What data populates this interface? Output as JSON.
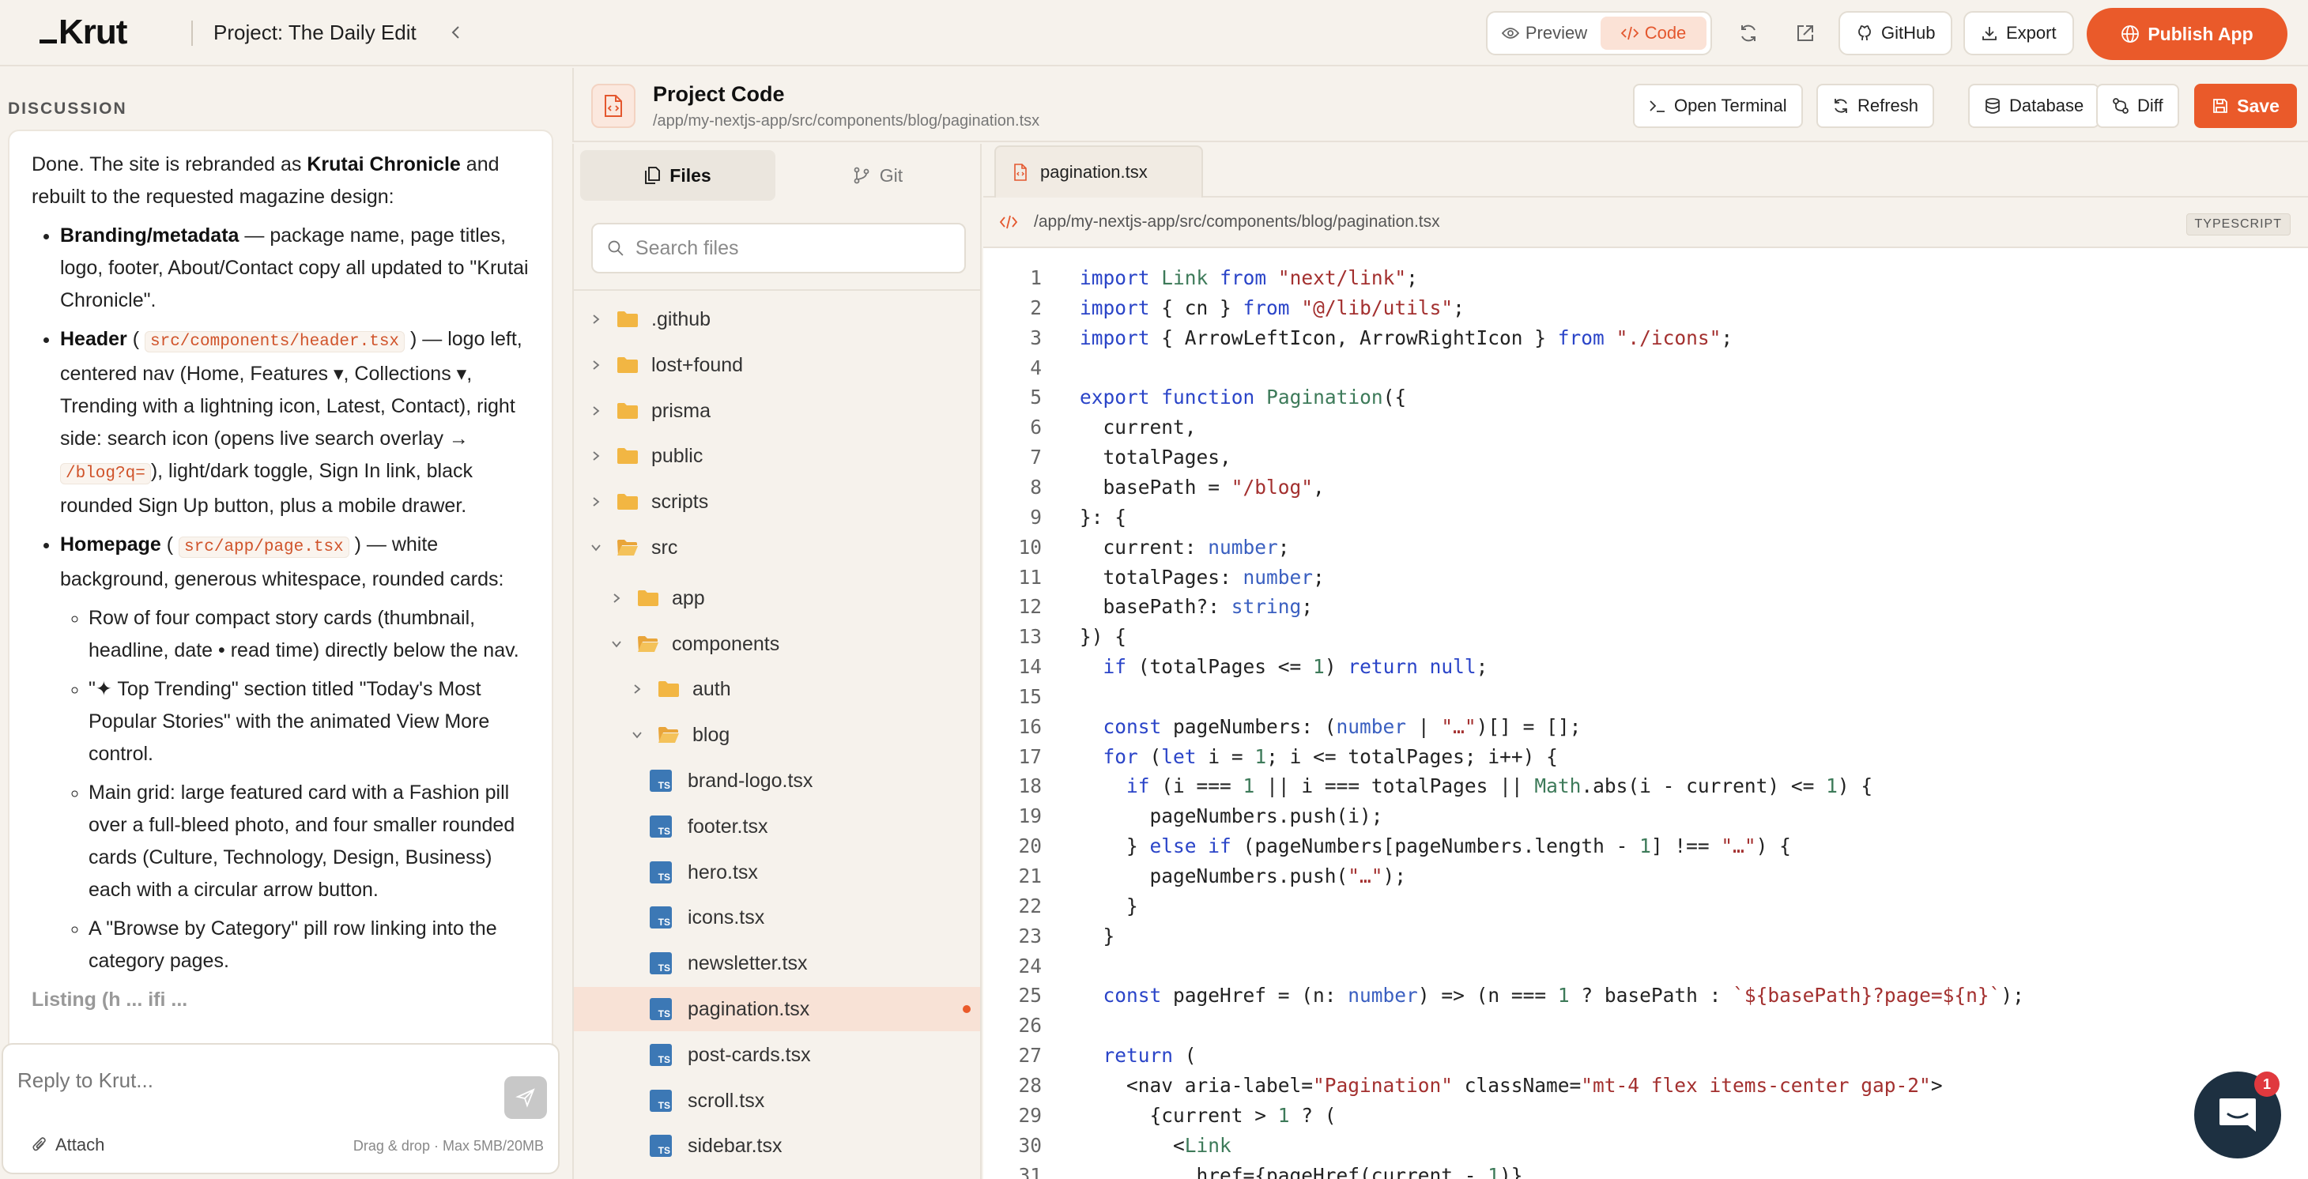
{
  "app": {
    "logo": "Krut",
    "project_title": "Project: The Daily Edit"
  },
  "topbar": {
    "preview_label": "Preview",
    "code_label": "Code",
    "github_label": "GitHub",
    "export_label": "Export",
    "publish_label": "Publish App"
  },
  "discussion": {
    "section_label": "DISCUSSION",
    "intro_pre": "Done. The site is rebranded as ",
    "intro_brand": "Krutai Chronicle",
    "intro_post": " and rebuilt to the requested magazine design:",
    "items": [
      {
        "title": "Branding/metadata",
        "text": " — package name, page titles, logo, footer, About/Contact copy all updated to \"Krutai Chronicle\"."
      },
      {
        "title": "Header",
        "code": "src/components/header.tsx",
        "text_a": " — logo left, centered nav (Home, Features ▾, Collections ▾, Trending with a lightning icon, Latest, Contact), right side: search icon (opens live search overlay → ",
        "code2": "/blog?q=",
        "text_b": "), light/dark toggle, Sign In link, black rounded Sign Up button, plus a mobile drawer."
      },
      {
        "title": "Homepage",
        "code": "src/app/page.tsx",
        "text": " — white background, generous whitespace, rounded cards:",
        "sub": [
          "Row of four compact story cards (thumbnail, headline, date • read time) directly below the nav.",
          "\"✦ Top Trending\" section titled \"Today's Most Popular Stories\" with the animated View More control.",
          "Main grid: large featured card with a Fashion pill over a full-bleed photo, and four smaller rounded cards (Culture, Technology, Design, Business) each with a circular arrow button.",
          "A \"Browse by Category\" pill row linking into the category pages."
        ]
      }
    ],
    "fade_text": "Listing (h ... ifi ..."
  },
  "reply": {
    "placeholder": "Reply to Krut...",
    "attach_label": "Attach",
    "drop_note": "Drag & drop · Max 5MB/20MB"
  },
  "project_code": {
    "title": "Project Code",
    "path": "/app/my-nextjs-app/src/components/blog/pagination.tsx",
    "open_terminal_label": "Open Terminal",
    "refresh_label": "Refresh",
    "database_label": "Database",
    "diff_label": "Diff",
    "save_label": "Save"
  },
  "tree": {
    "files_tab": "Files",
    "git_tab": "Git",
    "search_placeholder": "Search files",
    "rows": [
      {
        "label": ".github",
        "kind": "folder",
        "depth": 0,
        "open": false
      },
      {
        "label": "lost+found",
        "kind": "folder",
        "depth": 0,
        "open": false
      },
      {
        "label": "prisma",
        "kind": "folder",
        "depth": 0,
        "open": false
      },
      {
        "label": "public",
        "kind": "folder",
        "depth": 0,
        "open": false
      },
      {
        "label": "scripts",
        "kind": "folder",
        "depth": 0,
        "open": false
      },
      {
        "label": "src",
        "kind": "folder-open",
        "depth": 0,
        "open": true
      },
      {
        "label": "app",
        "kind": "folder",
        "depth": 1,
        "open": false
      },
      {
        "label": "components",
        "kind": "folder-open",
        "depth": 1,
        "open": true
      },
      {
        "label": "auth",
        "kind": "folder",
        "depth": 2,
        "open": false
      },
      {
        "label": "blog",
        "kind": "folder-open",
        "depth": 2,
        "open": true
      },
      {
        "label": "brand-logo.tsx",
        "kind": "file",
        "depth": 3
      },
      {
        "label": "footer.tsx",
        "kind": "file",
        "depth": 3
      },
      {
        "label": "hero.tsx",
        "kind": "file",
        "depth": 3
      },
      {
        "label": "icons.tsx",
        "kind": "file",
        "depth": 3
      },
      {
        "label": "newsletter.tsx",
        "kind": "file",
        "depth": 3
      },
      {
        "label": "pagination.tsx",
        "kind": "file",
        "depth": 3,
        "selected": true,
        "modified": true
      },
      {
        "label": "post-cards.tsx",
        "kind": "file",
        "depth": 3
      },
      {
        "label": "scroll.tsx",
        "kind": "file",
        "depth": 3
      },
      {
        "label": "sidebar.tsx",
        "kind": "file",
        "depth": 3
      }
    ]
  },
  "editor": {
    "tab_label": "pagination.tsx",
    "path": "/app/my-nextjs-app/src/components/blog/pagination.tsx",
    "language": "TYPESCRIPT",
    "lines": [
      "import Link from \"next/link\";",
      "import { cn } from \"@/lib/utils\";",
      "import { ArrowLeftIcon, ArrowRightIcon } from \"./icons\";",
      "",
      "export function Pagination({",
      "  current,",
      "  totalPages,",
      "  basePath = \"/blog\",",
      "}: {",
      "  current: number;",
      "  totalPages: number;",
      "  basePath?: string;",
      "}) {",
      "  if (totalPages <= 1) return null;",
      "",
      "  const pageNumbers: (number | \"…\")[] = [];",
      "  for (let i = 1; i <= totalPages; i++) {",
      "    if (i === 1 || i === totalPages || Math.abs(i - current) <= 1) {",
      "      pageNumbers.push(i);",
      "    } else if (pageNumbers[pageNumbers.length - 1] !== \"…\") {",
      "      pageNumbers.push(\"…\");",
      "    }",
      "  }",
      "",
      "  const pageHref = (n: number) => (n === 1 ? basePath : `${basePath}?page=${n}`);",
      "",
      "  return (",
      "    <nav aria-label=\"Pagination\" className=\"mt-4 flex items-center gap-2\">",
      "      {current > 1 ? (",
      "        <Link",
      "          href={pageHref(current - 1)}"
    ]
  },
  "chat_widget": {
    "badge": "1"
  },
  "colors": {
    "accent": "#ea5a2a",
    "background": "#f6f2ec",
    "selected_row": "#f8e2d6",
    "ts_icon": "#3c78b5",
    "folder": "#f2b643"
  }
}
